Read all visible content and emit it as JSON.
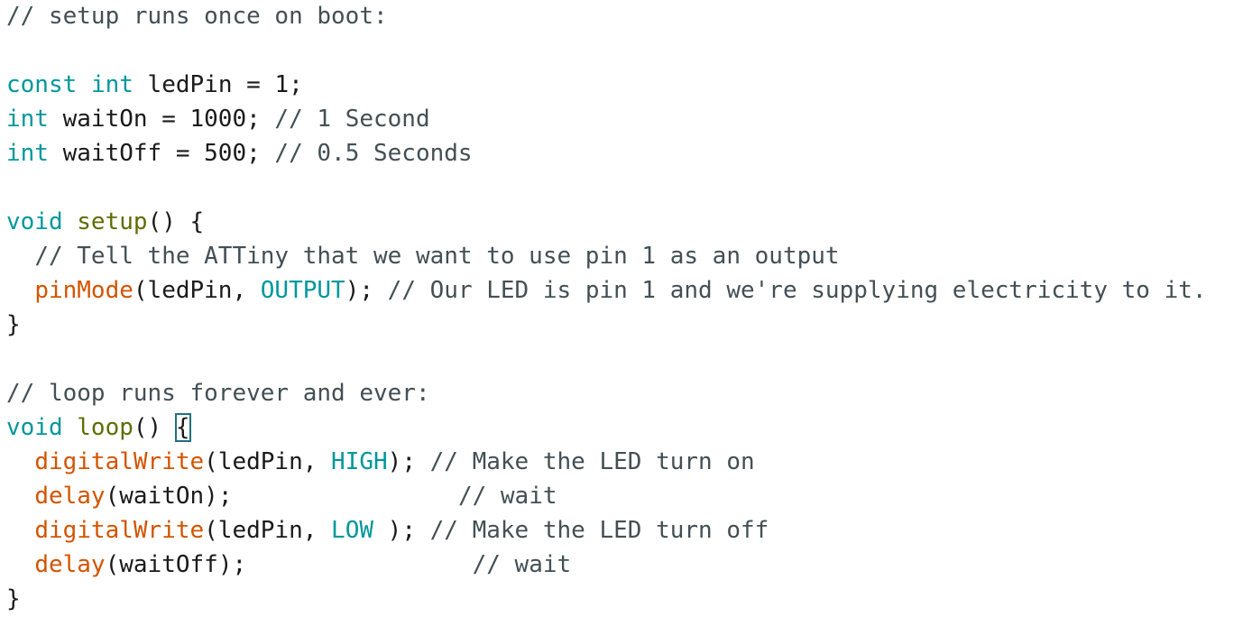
{
  "code_lines": [
    [
      {
        "t": "// setup runs once on boot:",
        "k": "comment"
      }
    ],
    [],
    [
      {
        "t": "const",
        "k": "type"
      },
      {
        "t": " ",
        "k": "plain"
      },
      {
        "t": "int",
        "k": "type"
      },
      {
        "t": " ledPin = 1;",
        "k": "plain"
      }
    ],
    [
      {
        "t": "int",
        "k": "type"
      },
      {
        "t": " waitOn = 1000; ",
        "k": "plain"
      },
      {
        "t": "// 1 Second",
        "k": "comment"
      }
    ],
    [
      {
        "t": "int",
        "k": "type"
      },
      {
        "t": " waitOff = 500; ",
        "k": "plain"
      },
      {
        "t": "// 0.5 Seconds",
        "k": "comment"
      }
    ],
    [],
    [
      {
        "t": "void",
        "k": "type"
      },
      {
        "t": " ",
        "k": "plain"
      },
      {
        "t": "setup",
        "k": "fn-decl"
      },
      {
        "t": "() {",
        "k": "plain"
      }
    ],
    [
      {
        "t": "  ",
        "k": "plain"
      },
      {
        "t": "// Tell the ATTiny that we want to use pin 1 as an output",
        "k": "comment"
      }
    ],
    [
      {
        "t": "  ",
        "k": "plain"
      },
      {
        "t": "pinMode",
        "k": "func"
      },
      {
        "t": "(ledPin, ",
        "k": "plain"
      },
      {
        "t": "OUTPUT",
        "k": "const"
      },
      {
        "t": "); ",
        "k": "plain"
      },
      {
        "t": "// Our LED is pin 1 and we're supplying electricity to it.",
        "k": "comment"
      }
    ],
    [
      {
        "t": "}",
        "k": "plain"
      }
    ],
    [],
    [
      {
        "t": "// loop runs forever and ever:",
        "k": "comment"
      }
    ],
    [
      {
        "t": "void",
        "k": "type"
      },
      {
        "t": " ",
        "k": "plain"
      },
      {
        "t": "loop",
        "k": "fn-decl"
      },
      {
        "t": "() ",
        "k": "plain"
      },
      {
        "t": "{",
        "k": "cursor"
      }
    ],
    [
      {
        "t": "  ",
        "k": "plain"
      },
      {
        "t": "digitalWrite",
        "k": "func"
      },
      {
        "t": "(ledPin, ",
        "k": "plain"
      },
      {
        "t": "HIGH",
        "k": "const"
      },
      {
        "t": "); ",
        "k": "plain"
      },
      {
        "t": "// Make the LED turn on",
        "k": "comment"
      }
    ],
    [
      {
        "t": "  ",
        "k": "plain"
      },
      {
        "t": "delay",
        "k": "func"
      },
      {
        "t": "(waitOn);                ",
        "k": "plain"
      },
      {
        "t": "// wait",
        "k": "comment"
      }
    ],
    [
      {
        "t": "  ",
        "k": "plain"
      },
      {
        "t": "digitalWrite",
        "k": "func"
      },
      {
        "t": "(ledPin, ",
        "k": "plain"
      },
      {
        "t": "LOW",
        "k": "const"
      },
      {
        "t": " ); ",
        "k": "plain"
      },
      {
        "t": "// Make the LED turn off",
        "k": "comment"
      }
    ],
    [
      {
        "t": "  ",
        "k": "plain"
      },
      {
        "t": "delay",
        "k": "func"
      },
      {
        "t": "(waitOff);                ",
        "k": "plain"
      },
      {
        "t": "// wait",
        "k": "comment"
      }
    ],
    [
      {
        "t": "}",
        "k": "plain"
      }
    ]
  ],
  "colors": {
    "type": "#00979c",
    "function": "#d35400",
    "function_declaration": "#5e6d03",
    "comment": "#434f54",
    "plain": "#1a1a1a",
    "background": "#ffffff"
  }
}
